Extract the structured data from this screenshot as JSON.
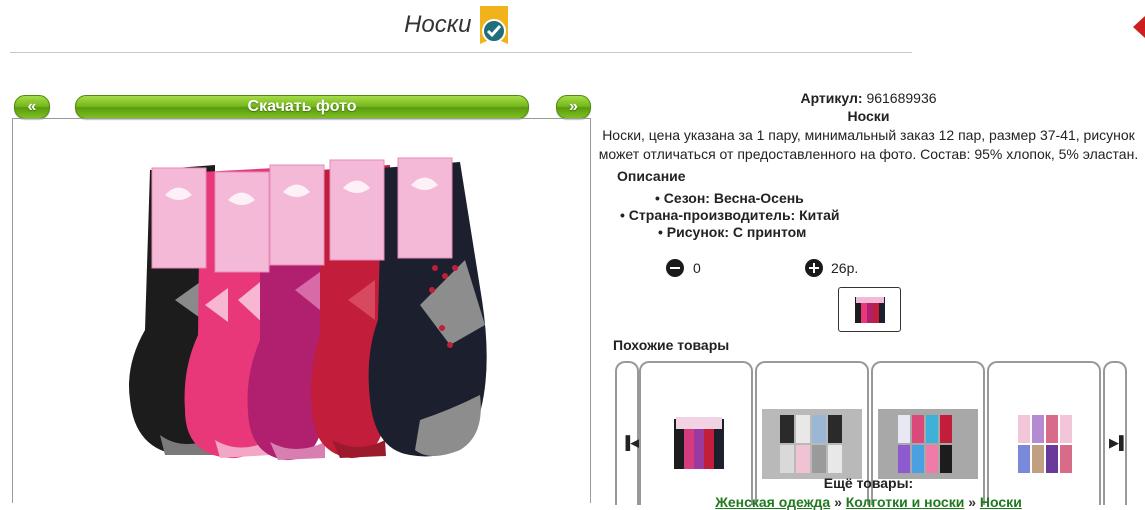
{
  "header": {
    "title": "Носки"
  },
  "gallery": {
    "prev_label": "«",
    "download_label": "Скачать фото",
    "next_label": "»"
  },
  "product": {
    "article_label": "Артикул:",
    "article_value": "961689936",
    "name": "Носки",
    "description": "Носки, цена указана за 1 пару, минимальный заказ 12 пар, размер 37-41, рисунок может отличаться от предоставленного на фото. Состав: 95% хлопок, 5% эластан.",
    "spec_heading": "Описание",
    "specs": [
      "Сезон: Весна-Осень",
      "Страна-производитель: Китай",
      "Рисунок: С принтом"
    ],
    "quantity": "0",
    "price": "26р."
  },
  "similar": {
    "heading": "Похожие товары"
  },
  "more": {
    "heading": "Ещё товары:",
    "breadcrumb": [
      "Женская одежда",
      "Колготки и носки",
      "Носки"
    ],
    "separator": "»"
  },
  "colors": {
    "accent_green": "#74b61c",
    "link_green": "#1f7a1f",
    "sock_colors": [
      "#1c1c1c",
      "#e8387a",
      "#b0206e",
      "#c21d3a",
      "#1b1f2e"
    ]
  }
}
